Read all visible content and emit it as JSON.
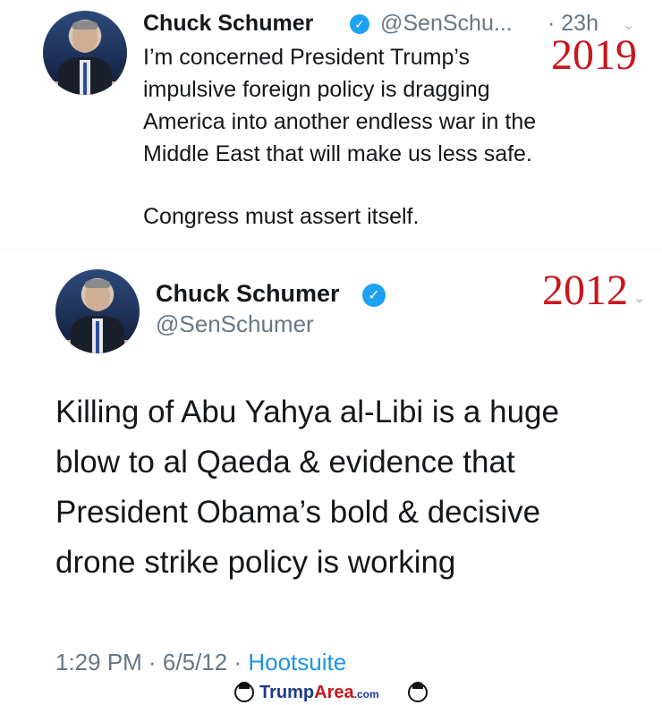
{
  "tweet_top": {
    "name": "Chuck Schumer",
    "handle": "@SenSchu...",
    "time": "· 23h",
    "year_overlay": "2019",
    "text_lines": [
      "I’m concerned President Trump’s",
      "impulsive foreign policy is dragging",
      "America into another endless war in the",
      "Middle East that will make us less safe.",
      "",
      "Congress must assert itself."
    ]
  },
  "tweet_bottom": {
    "name": "Chuck Schumer",
    "handle": "@SenSchumer",
    "year_overlay": "2012",
    "text_lines": [
      "Killing of Abu Yahya al-Libi is a huge",
      "blow to al Qaeda & evidence that",
      "President Obama’s bold & decisive",
      "drone strike policy is working"
    ],
    "meta_time": "1:29 PM · 6/5/12 · ",
    "meta_source": "Hootsuite"
  },
  "footer": {
    "logo_part1": "Trump",
    "logo_part2": "Area",
    "logo_part3": ".com"
  },
  "colors": {
    "year_overlay": "#c8161d",
    "verified": "#1da1f2",
    "link": "#1b95e0",
    "muted": "#657786"
  },
  "icons": {
    "verified": "verified-badge-icon",
    "caret": "chevron-down-icon"
  }
}
